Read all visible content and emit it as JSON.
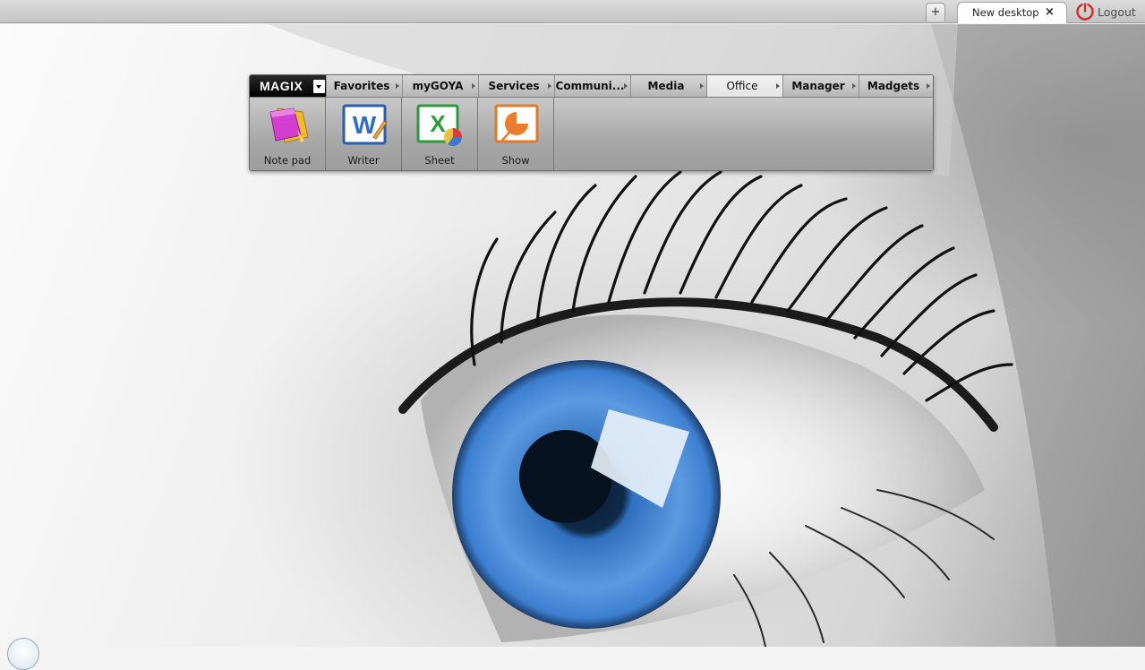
{
  "topbar": {
    "add_tab_label": "+",
    "tab_label": "New desktop",
    "tab_close": "×",
    "logout_label": "Logout"
  },
  "menu": {
    "brand": "MAGIX",
    "items": [
      {
        "label": "Favorites"
      },
      {
        "label": "myGOYA"
      },
      {
        "label": "Services"
      },
      {
        "label": "Communi..."
      },
      {
        "label": "Media"
      },
      {
        "label": "Office",
        "active": true
      },
      {
        "label": "Manager"
      },
      {
        "label": "Madgets"
      }
    ]
  },
  "apps": [
    {
      "label": "Note pad",
      "icon": "notepad-icon"
    },
    {
      "label": "Writer",
      "icon": "writer-icon"
    },
    {
      "label": "Sheet",
      "icon": "sheet-icon"
    },
    {
      "label": "Show",
      "icon": "show-icon"
    }
  ],
  "colors": {
    "logout_power": "#d42a2a",
    "brand_bg": "#000000",
    "iris": "#3d7fd1"
  }
}
